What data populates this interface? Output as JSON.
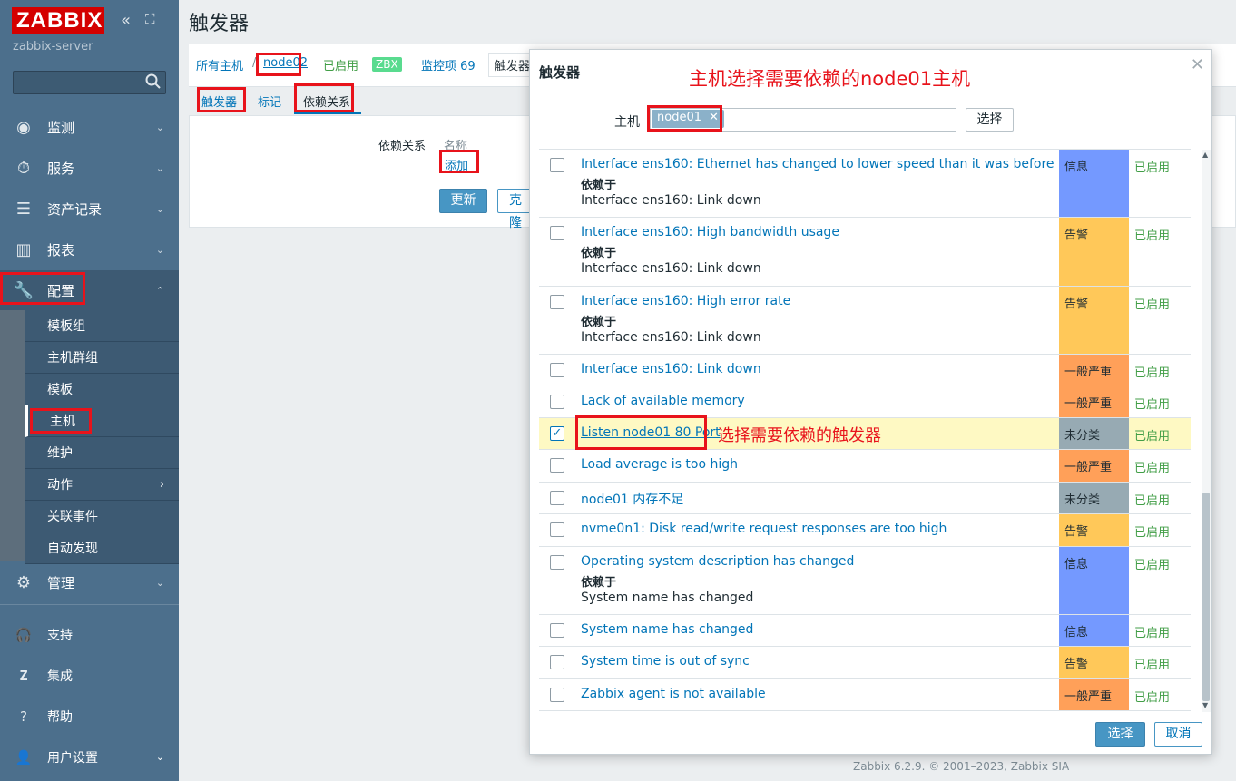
{
  "sidebar": {
    "logo": "ZABBIX",
    "server": "zabbix-server",
    "collapse_icon": "«",
    "expand_icon": "⛶",
    "menu": [
      {
        "label": "监测",
        "icon": "eye-icon"
      },
      {
        "label": "服务",
        "icon": "stopwatch-icon"
      },
      {
        "label": "资产记录",
        "icon": "list-icon"
      },
      {
        "label": "报表",
        "icon": "bar-chart-icon"
      },
      {
        "label": "配置",
        "icon": "wrench-icon"
      }
    ],
    "submenu": [
      "模板组",
      "主机群组",
      "模板",
      "主机",
      "维护",
      "动作",
      "关联事件",
      "自动发现"
    ],
    "manage": "管理",
    "bottom": [
      "支持",
      "集成",
      "帮助",
      "用户设置"
    ]
  },
  "page": {
    "title": "触发器",
    "breadcrumbs": {
      "all_hosts": "所有主机",
      "sep": "/",
      "host": "node02",
      "enabled": "已启用",
      "zbx": "ZBX",
      "items": "监控项 69",
      "triggers": "触发器"
    },
    "tabs": [
      "触发器",
      "标记",
      "依赖关系"
    ],
    "form": {
      "label": "依赖关系",
      "col": "名称",
      "add": "添加",
      "update": "更新",
      "clone": "克隆"
    },
    "footer": "Zabbix 6.2.9. © 2001–2023, Zabbix SIA"
  },
  "modal": {
    "title": "触发器",
    "annotation_host": "主机选择需要依赖的node01主机",
    "annotation_trigger": "选择需要依赖的触发器",
    "host_label": "主机",
    "host_value": "node01",
    "select": "选择",
    "dep_label": "依赖于",
    "rows": [
      {
        "name": "Interface ens160: Ethernet has changed to lower speed than it was before",
        "dep": "Interface ens160: Link down",
        "severity": "信息",
        "sev_color": "#7499ff",
        "status": "已启用",
        "checked": false
      },
      {
        "name": "Interface ens160: High bandwidth usage",
        "dep": "Interface ens160: Link down",
        "severity": "告警",
        "sev_color": "#ffc859",
        "status": "已启用",
        "checked": false
      },
      {
        "name": "Interface ens160: High error rate",
        "dep": "Interface ens160: Link down",
        "severity": "告警",
        "sev_color": "#ffc859",
        "status": "已启用",
        "checked": false
      },
      {
        "name": "Interface ens160: Link down",
        "dep": "",
        "severity": "一般严重",
        "sev_color": "#ffa059",
        "status": "已启用",
        "checked": false
      },
      {
        "name": "Lack of available memory",
        "dep": "",
        "severity": "一般严重",
        "sev_color": "#ffa059",
        "status": "已启用",
        "checked": false
      },
      {
        "name": "Listen node01 80 Port",
        "dep": "",
        "severity": "未分类",
        "sev_color": "#97aab3",
        "status": "已启用",
        "checked": true
      },
      {
        "name": "Load average is too high",
        "dep": "",
        "severity": "一般严重",
        "sev_color": "#ffa059",
        "status": "已启用",
        "checked": false
      },
      {
        "name": "node01 内存不足",
        "dep": "",
        "severity": "未分类",
        "sev_color": "#97aab3",
        "status": "已启用",
        "checked": false
      },
      {
        "name": "nvme0n1: Disk read/write request responses are too high",
        "dep": "",
        "severity": "告警",
        "sev_color": "#ffc859",
        "status": "已启用",
        "checked": false
      },
      {
        "name": "Operating system description has changed",
        "dep": "System name has changed",
        "severity": "信息",
        "sev_color": "#7499ff",
        "status": "已启用",
        "checked": false
      },
      {
        "name": "System name has changed",
        "dep": "",
        "severity": "信息",
        "sev_color": "#7499ff",
        "status": "已启用",
        "checked": false
      },
      {
        "name": "System time is out of sync",
        "dep": "",
        "severity": "告警",
        "sev_color": "#ffc859",
        "status": "已启用",
        "checked": false
      },
      {
        "name": "Zabbix agent is not available",
        "dep": "",
        "severity": "一般严重",
        "sev_color": "#ffa059",
        "status": "已启用",
        "checked": false
      }
    ],
    "btn_select": "选择",
    "btn_cancel": "取消"
  }
}
